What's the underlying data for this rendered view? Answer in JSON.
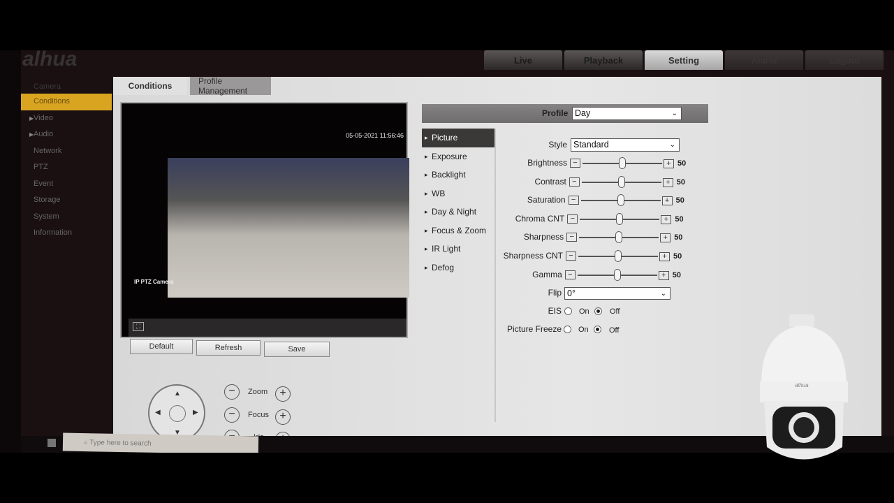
{
  "brand": "alhua",
  "topnav": {
    "tabs": [
      {
        "label": "Live"
      },
      {
        "label": "Playback"
      },
      {
        "label": "Setting",
        "active": true
      },
      {
        "label": "Alarm"
      },
      {
        "label": "Logout"
      }
    ]
  },
  "sidebar": {
    "header": "Camera",
    "items": [
      {
        "label": "Conditions",
        "selected": true
      },
      {
        "label": "Video",
        "expandable": true
      },
      {
        "label": "Audio",
        "expandable": true
      },
      {
        "label": "Network"
      },
      {
        "label": "PTZ"
      },
      {
        "label": "Event"
      },
      {
        "label": "Storage"
      },
      {
        "label": "System"
      },
      {
        "label": "Information"
      }
    ],
    "selected_color": "#d9a521"
  },
  "subtabs": [
    {
      "label": "Conditions",
      "active": true
    },
    {
      "label": "Profile Management"
    }
  ],
  "video": {
    "timestamp": "05-05-2021 11:56:46",
    "camera_name": "IP PTZ Camera",
    "fullscreen_icon": "fullscreen-icon"
  },
  "buttons": {
    "default": "Default",
    "refresh": "Refresh",
    "save": "Save"
  },
  "ptz_controls": {
    "zoom": "Zoom",
    "focus": "Focus",
    "iris": "Iris",
    "minus": "−",
    "plus": "+"
  },
  "profile": {
    "label": "Profile",
    "value": "Day"
  },
  "menu": {
    "items": [
      {
        "label": "Picture",
        "selected": true
      },
      {
        "label": "Exposure"
      },
      {
        "label": "Backlight"
      },
      {
        "label": "WB"
      },
      {
        "label": "Day & Night"
      },
      {
        "label": "Focus & Zoom"
      },
      {
        "label": "IR Light"
      },
      {
        "label": "Defog"
      }
    ]
  },
  "picture": {
    "style": {
      "label": "Style",
      "value": "Standard"
    },
    "sliders": [
      {
        "label": "Brightness",
        "value": 50
      },
      {
        "label": "Contrast",
        "value": 50
      },
      {
        "label": "Saturation",
        "value": 50
      },
      {
        "label": "Chroma CNT",
        "value": 50
      },
      {
        "label": "Sharpness",
        "value": 50
      },
      {
        "label": "Sharpness CNT",
        "value": 50
      },
      {
        "label": "Gamma",
        "value": 50
      }
    ],
    "flip": {
      "label": "Flip",
      "value": "0°"
    },
    "eis": {
      "label": "EIS",
      "on": "On",
      "off": "Off",
      "selected": "Off"
    },
    "picture_freeze": {
      "label": "Picture Freeze",
      "on": "On",
      "off": "Off",
      "selected": "Off"
    }
  },
  "taskbar": {
    "search_placeholder": "Type here to search"
  }
}
